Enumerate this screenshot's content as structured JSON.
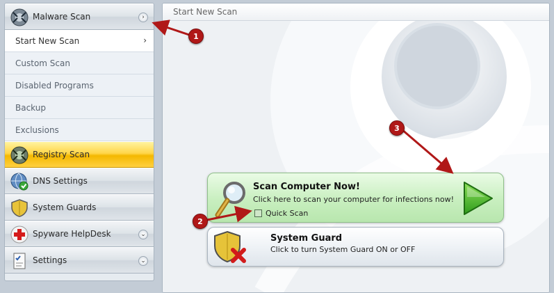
{
  "sidebar": {
    "malware_scan": {
      "label": "Malware Scan",
      "chevron": "›"
    },
    "subitems": [
      {
        "label": "Start New Scan",
        "arrow": "›"
      },
      {
        "label": "Custom Scan"
      },
      {
        "label": "Disabled Programs"
      },
      {
        "label": "Backup"
      },
      {
        "label": "Exclusions"
      }
    ],
    "sections": [
      {
        "label": "Registry Scan"
      },
      {
        "label": "DNS Settings"
      },
      {
        "label": "System Guards"
      },
      {
        "label": "Spyware HelpDesk",
        "chevron": "⌄"
      },
      {
        "label": "Settings",
        "chevron": "⌄"
      }
    ]
  },
  "main": {
    "header": "Start New Scan",
    "scan_button": {
      "title": "Scan Computer Now!",
      "description": "Click here to scan your computer for infections now!",
      "quick_scan_label": "Quick Scan",
      "quick_scan_checked": false,
      "icon": "magnifier-icon",
      "play_icon": "play-icon"
    },
    "guard_button": {
      "title": "System Guard",
      "description": "Click to turn System Guard ON or OFF",
      "icon": "shield-x-icon"
    }
  },
  "annotations": [
    {
      "number": "1"
    },
    {
      "number": "2"
    },
    {
      "number": "3"
    }
  ],
  "colors": {
    "annotation_red": "#b01818",
    "active_section_yellow": "#f4b800",
    "scan_button_green": "#c8efbf"
  }
}
